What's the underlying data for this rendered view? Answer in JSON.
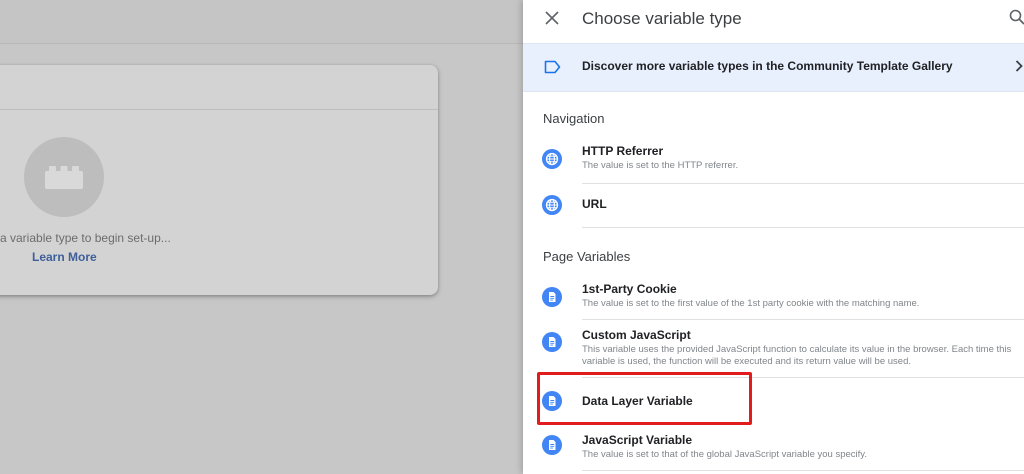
{
  "background": {
    "hint_text": "a variable type to begin set-up...",
    "learn_more": "Learn More"
  },
  "panel": {
    "title": "Choose variable type",
    "close_icon": "close-icon",
    "search_icon": "search-icon",
    "gallery_banner": {
      "text": "Discover more variable types in the Community Template Gallery",
      "icon": "label-tag-icon"
    },
    "sections": {
      "navigation": {
        "heading": "Navigation",
        "items": [
          {
            "title": "HTTP Referrer",
            "desc": "The value is set to the HTTP referrer.",
            "icon": "globe-icon"
          },
          {
            "title": "URL",
            "desc": "",
            "icon": "globe-icon"
          }
        ]
      },
      "page_variables": {
        "heading": "Page Variables",
        "items": [
          {
            "title": "1st-Party Cookie",
            "desc": "The value is set to the first value of the 1st party cookie with the matching name.",
            "icon": "document-icon"
          },
          {
            "title": "Custom JavaScript",
            "desc": "This variable uses the provided JavaScript function to calculate its value in the browser. Each time this variable is used, the function will be executed and its return value will be used.",
            "icon": "document-icon"
          },
          {
            "title": "Data Layer Variable",
            "desc": "",
            "icon": "document-icon"
          },
          {
            "title": "JavaScript Variable",
            "desc": "The value is set to that of the global JavaScript variable you specify.",
            "icon": "document-icon"
          }
        ]
      }
    }
  },
  "colors": {
    "accent": "#4285f4",
    "banner_bg": "#e8f0fe",
    "highlight": "#e21c1c",
    "link": "#3e5f9a"
  }
}
